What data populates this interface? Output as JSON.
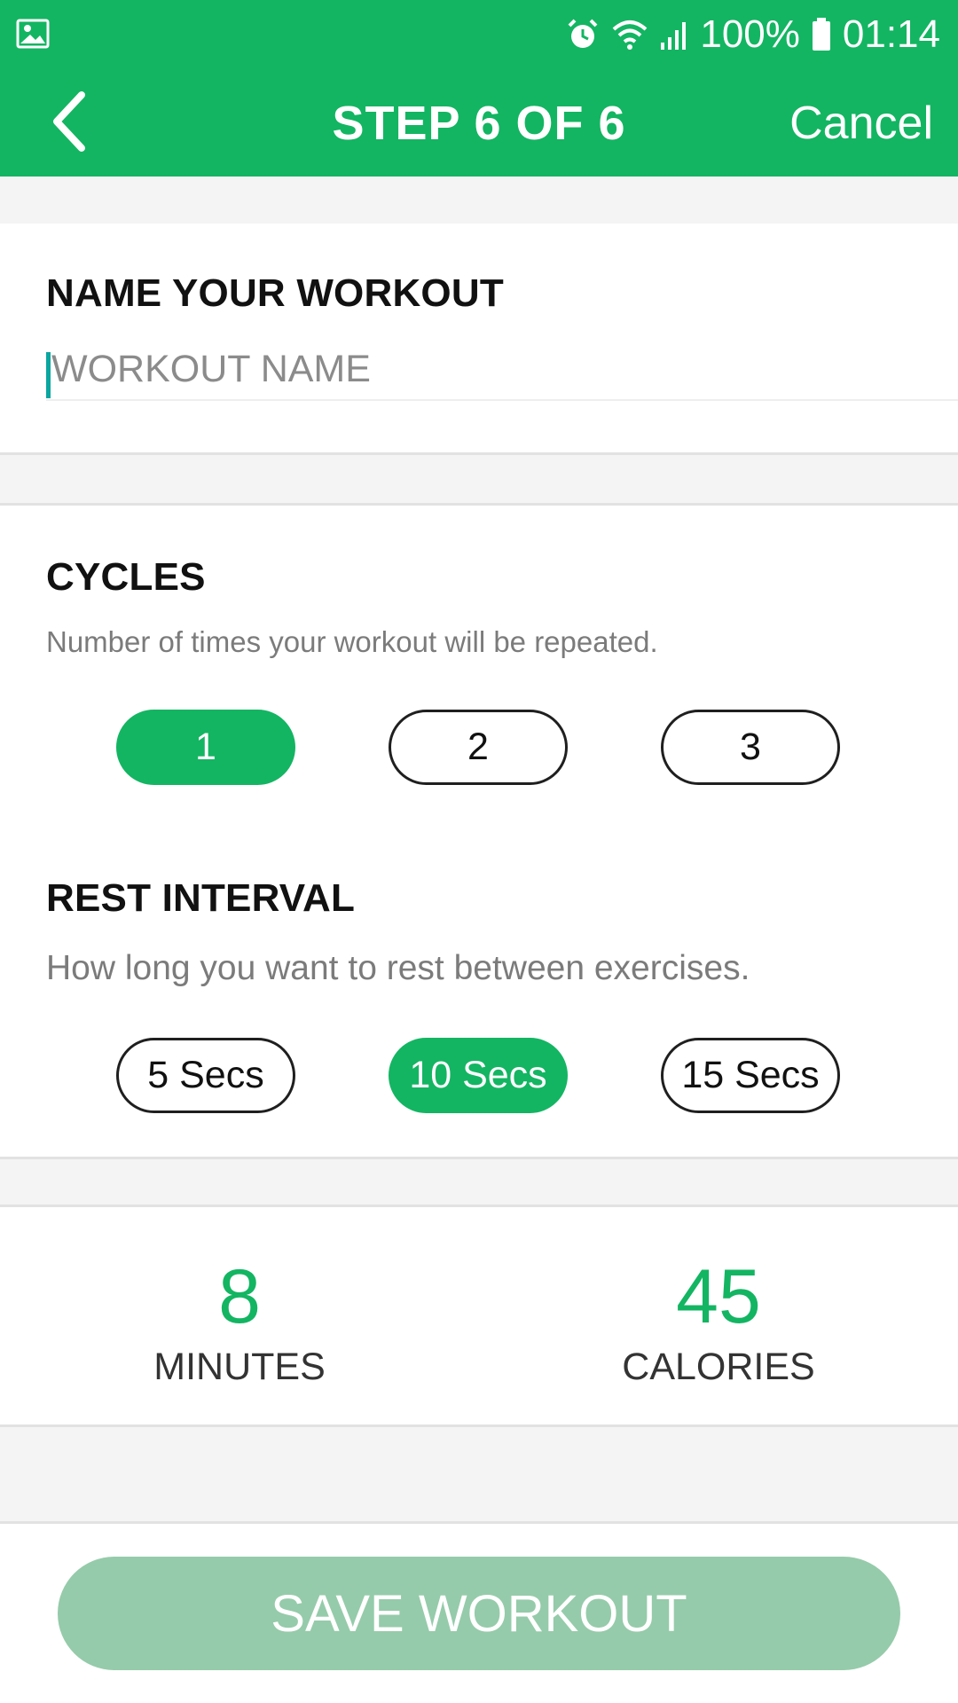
{
  "status_bar": {
    "icons": [
      "image-icon",
      "alarm-icon",
      "wifi-icon",
      "signal-icon",
      "battery-icon"
    ],
    "battery": "100%",
    "time": "01:14"
  },
  "app_bar": {
    "back_icon": "chevron-left-icon",
    "title": "STEP 6 OF 6",
    "cancel_label": "Cancel"
  },
  "workout_name": {
    "heading": "NAME YOUR WORKOUT",
    "placeholder": "WORKOUT NAME",
    "value": ""
  },
  "cycles": {
    "heading": "CYCLES",
    "description": "Number of times your workout will be repeated.",
    "options": [
      "1",
      "2",
      "3"
    ],
    "selected": "1"
  },
  "rest_interval": {
    "heading": "REST INTERVAL",
    "description": "How long you want to rest between exercises.",
    "options": [
      "5 Secs",
      "10 Secs",
      "15 Secs"
    ],
    "selected": "10 Secs"
  },
  "summary": {
    "minutes_value": "8",
    "minutes_label": "MINUTES",
    "calories_value": "45",
    "calories_label": "CALORIES"
  },
  "footer": {
    "save_label": "SAVE WORKOUT"
  },
  "colors": {
    "brand_green": "#13b562",
    "disabled_green": "#95cbaa",
    "background_gray": "#f4f4f4"
  }
}
